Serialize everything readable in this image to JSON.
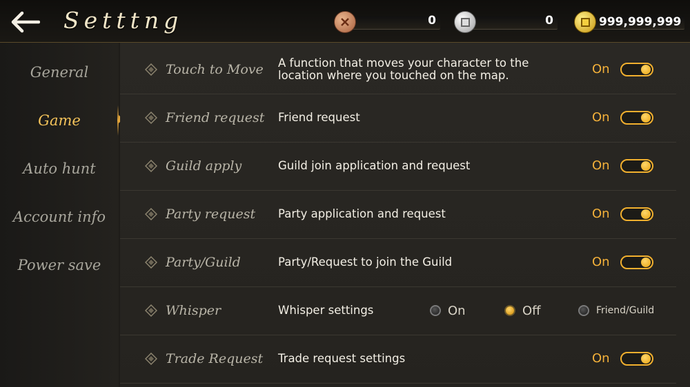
{
  "header": {
    "title": "Setttng",
    "back_icon": "arrow-left-icon",
    "currencies": [
      {
        "icon": "copper-coin-icon",
        "value": "0"
      },
      {
        "icon": "silver-coin-icon",
        "value": "0"
      },
      {
        "icon": "gold-coin-icon",
        "value": "999,999,999"
      }
    ]
  },
  "sidebar": {
    "items": [
      {
        "label": "General"
      },
      {
        "label": "Game"
      },
      {
        "label": "Auto hunt"
      },
      {
        "label": "Account info"
      },
      {
        "label": "Power save"
      }
    ],
    "active_index": 1
  },
  "settings": {
    "rows": [
      {
        "name": "Touch to Move",
        "description": "A function that moves your character to the location where you touched on the map.",
        "status": "On"
      },
      {
        "name": "Friend request",
        "description": "Friend request",
        "status": "On"
      },
      {
        "name": "Guild apply",
        "description": "Guild join application and request",
        "status": "On"
      },
      {
        "name": "Party request",
        "description": "Party application and request",
        "status": "On"
      },
      {
        "name": "Party/Guild",
        "description": "Party/Request to join the Guild",
        "status": "On"
      },
      {
        "name": "Whisper",
        "description": "Whisper settings",
        "options": [
          "On",
          "Off",
          "Friend/Guild"
        ],
        "selected": "Off"
      },
      {
        "name": "Trade Request",
        "description": "Trade request settings",
        "status": "On"
      }
    ]
  },
  "colors": {
    "accent": "#f4b13a",
    "active_tab": "#f4c35a",
    "background": "#25231f"
  }
}
